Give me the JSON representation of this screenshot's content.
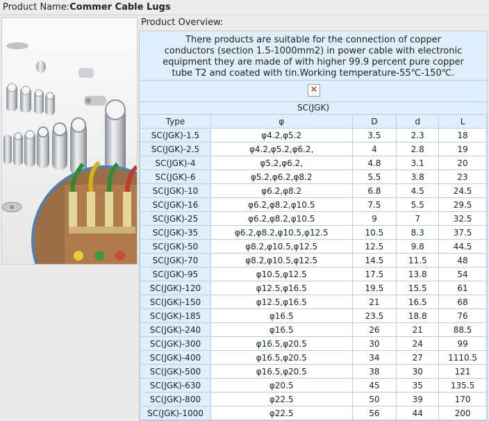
{
  "header": {
    "label": "Product Name:",
    "product_name": "Commer Cable Lugs"
  },
  "overview": {
    "heading": "Product Overview:",
    "description": "There products are suitable for the connection of copper conductors (section 1.5-1000mm2) in power cable with electronic equipment they are made of with higher 99.9 percent pure copper tube T2 and coated with tin.Working temperature-55℃-150℃.",
    "broken_image_symbol": "✕",
    "series_label": "SC(JGK)"
  },
  "table": {
    "columns": [
      "Type",
      "φ",
      "D",
      "d",
      "L"
    ],
    "rows": [
      [
        "SC(JGK)-1.5",
        "φ4.2,φ5.2",
        "3.5",
        "2.3",
        "18"
      ],
      [
        "SC(JGK)-2.5",
        "φ4.2,φ5.2,φ6.2,",
        "4",
        "2.8",
        "19"
      ],
      [
        "SC(JGK)-4",
        "φ5.2,φ6.2,",
        "4.8",
        "3.1",
        "20"
      ],
      [
        "SC(JGK)-6",
        "φ5.2,φ6.2,φ8.2",
        "5.5",
        "3.8",
        "23"
      ],
      [
        "SC(JGK)-10",
        "φ6.2,φ8.2",
        "6.8",
        "4.5",
        "24.5"
      ],
      [
        "SC(JGK)-16",
        "φ6.2,φ8.2,φ10.5",
        "7.5",
        "5.5",
        "29.5"
      ],
      [
        "SC(JGK)-25",
        "φ6.2,φ8.2,φ10.5",
        "9",
        "7",
        "32.5"
      ],
      [
        "SC(JGK)-35",
        "φ6.2,φ8.2,φ10.5,φ12.5",
        "10.5",
        "8.3",
        "37.5"
      ],
      [
        "SC(JGK)-50",
        "φ8.2,φ10.5,φ12.5",
        "12.5",
        "9.8",
        "44.5"
      ],
      [
        "SC(JGK)-70",
        "φ8.2,φ10.5,φ12.5",
        "14.5",
        "11.5",
        "48"
      ],
      [
        "SC(JGK)-95",
        "φ10.5,φ12.5",
        "17.5",
        "13.8",
        "54"
      ],
      [
        "SC(JGK)-120",
        "φ12.5,φ16.5",
        "19.5",
        "15.5",
        "61"
      ],
      [
        "SC(JGK)-150",
        "φ12.5,φ16.5",
        "21",
        "16.5",
        "68"
      ],
      [
        "SC(JGK)-185",
        "φ16.5",
        "23.5",
        "18.8",
        "76"
      ],
      [
        "SC(JGK)-240",
        "φ16.5",
        "26",
        "21",
        "88.5"
      ],
      [
        "SC(JGK)-300",
        "φ16.5,φ20.5",
        "30",
        "24",
        "99"
      ],
      [
        "SC(JGK)-400",
        "φ16.5,φ20.5",
        "34",
        "27",
        "1110.5"
      ],
      [
        "SC(JGK)-500",
        "φ16.5,φ20.5",
        "38",
        "30",
        "121"
      ],
      [
        "SC(JGK)-630",
        "φ20.5",
        "45",
        "35",
        "135.5"
      ],
      [
        "SC(JGK)-800",
        "φ22.5",
        "50",
        "39",
        "170"
      ],
      [
        "SC(JGK)-1000",
        "φ22.5",
        "56",
        "44",
        "200"
      ]
    ]
  }
}
